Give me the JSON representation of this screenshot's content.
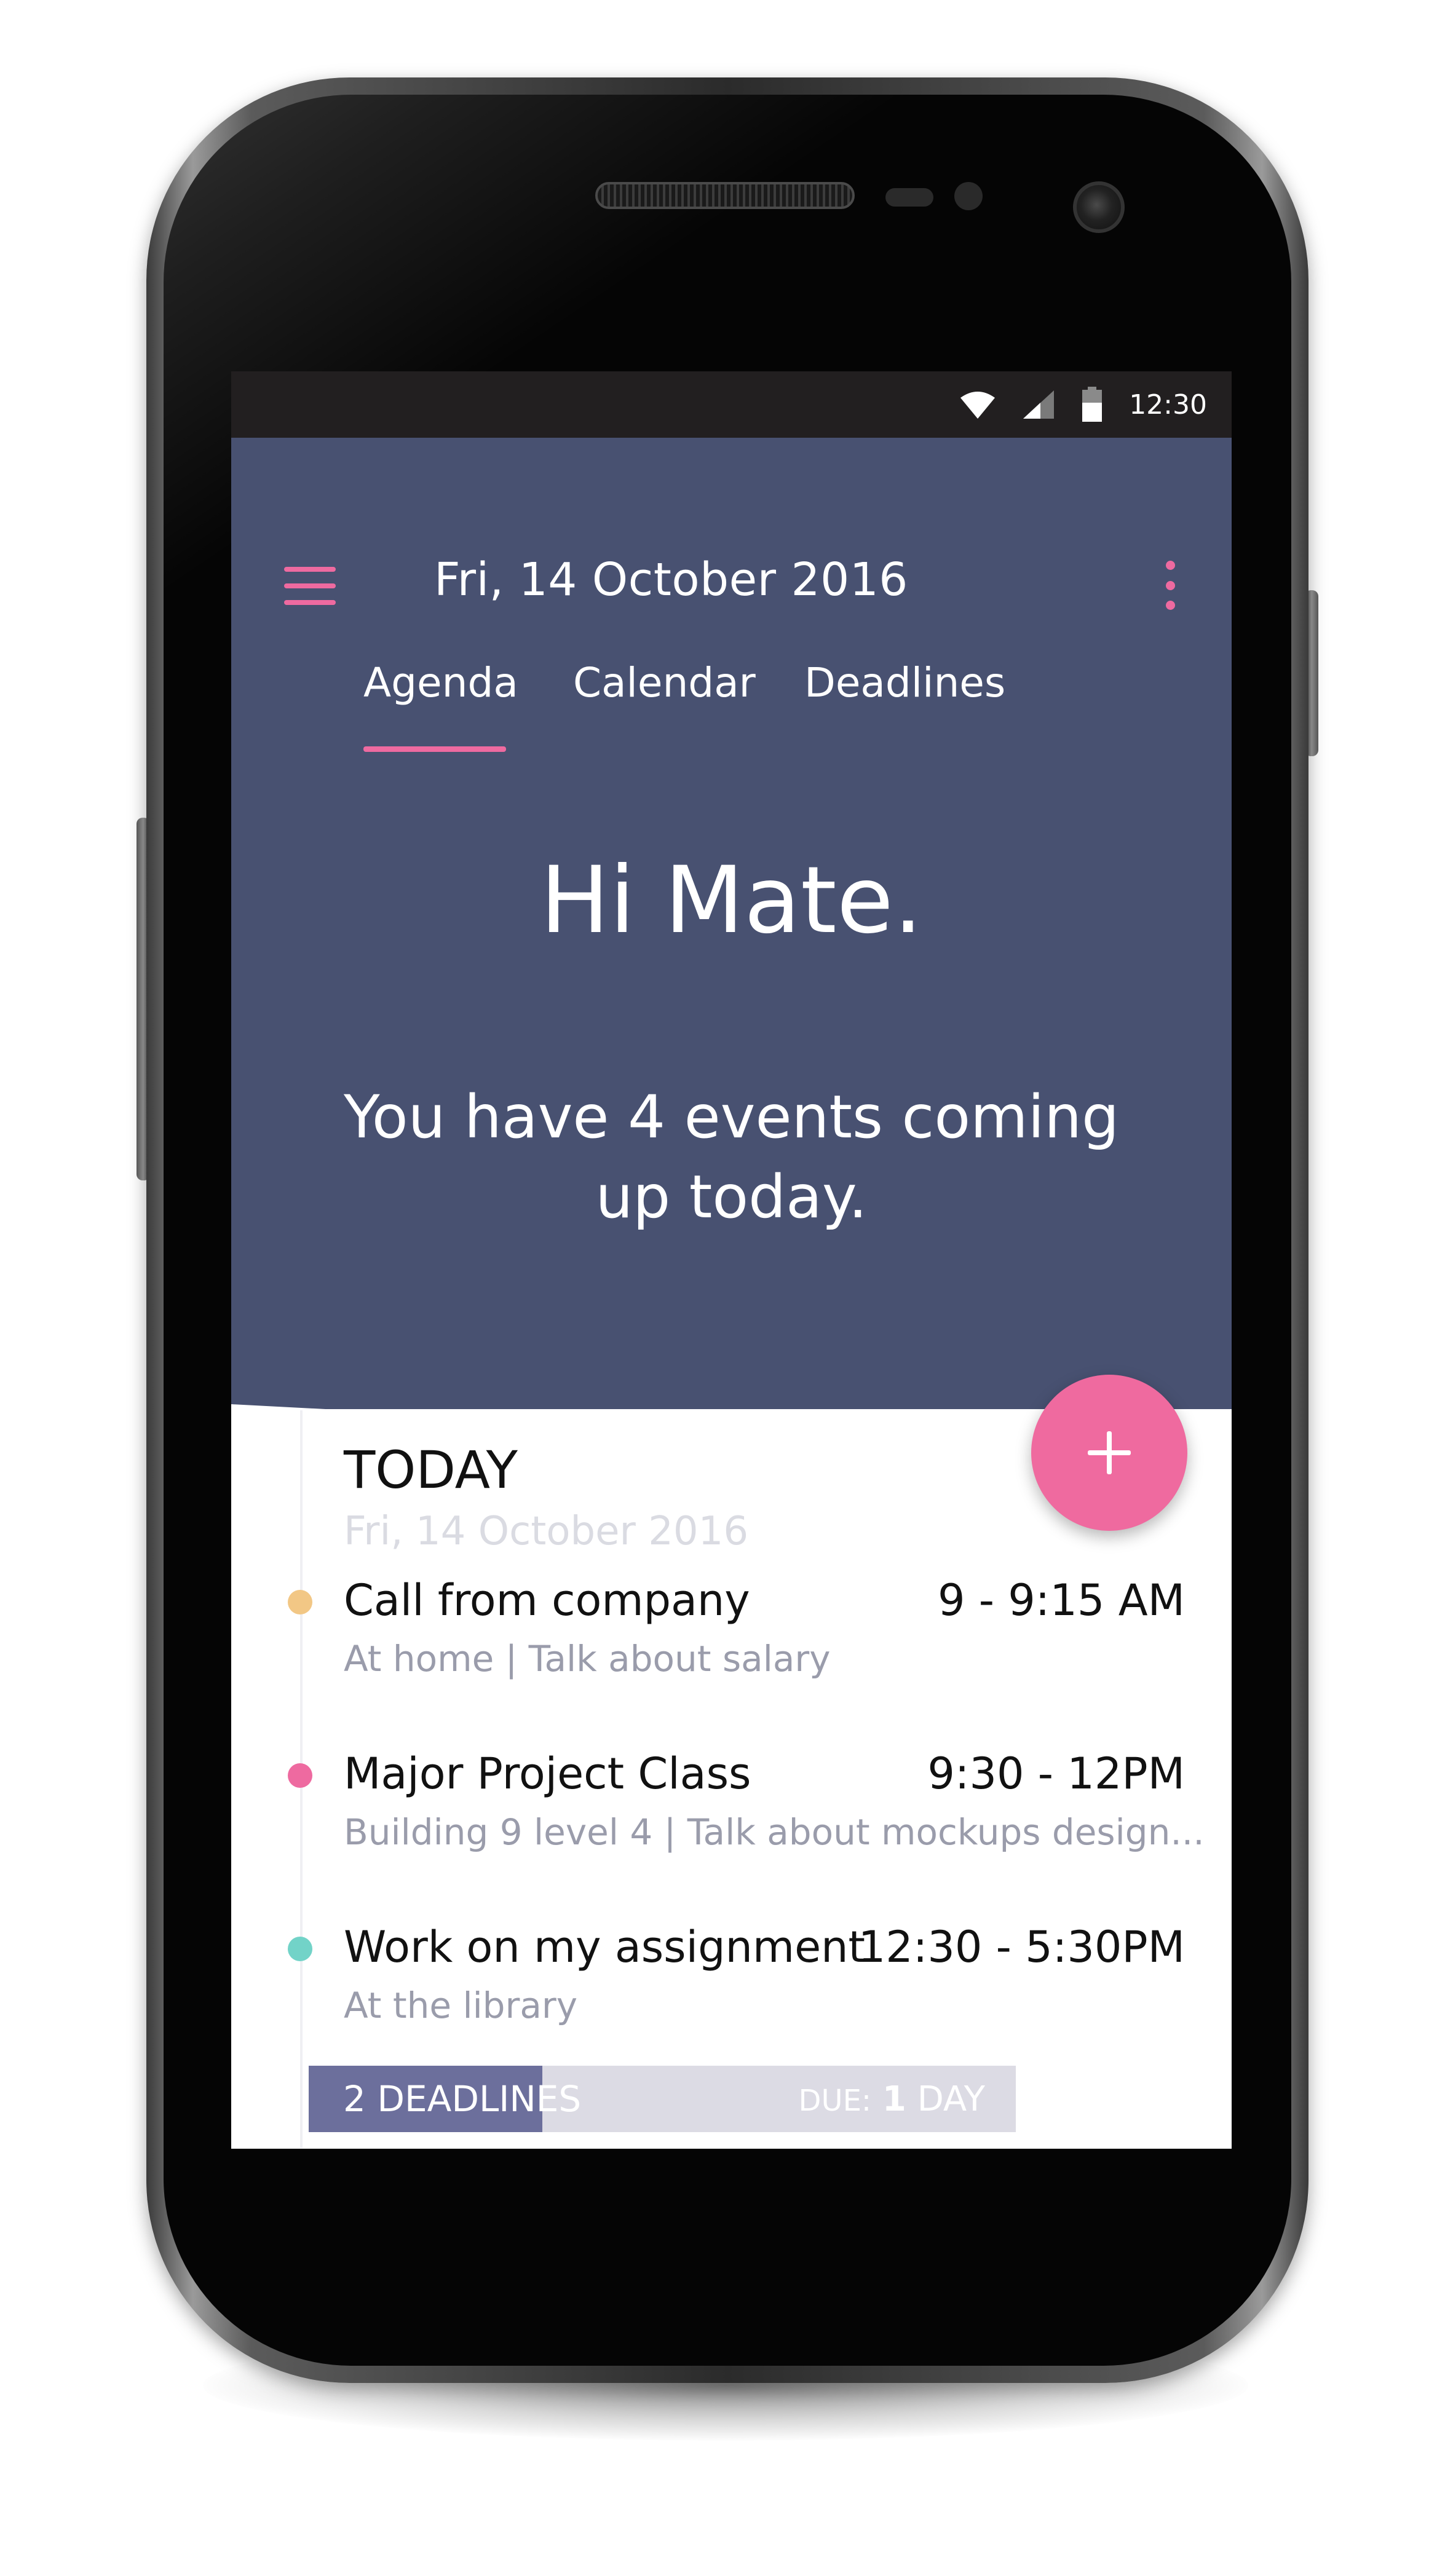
{
  "status_bar": {
    "time": "12:30"
  },
  "header": {
    "date_title": "Fri, 14 October 2016",
    "tabs": [
      {
        "label": "Agenda",
        "active": true
      },
      {
        "label": "Calendar",
        "active": false
      },
      {
        "label": "Deadlines",
        "active": false
      }
    ],
    "greeting": "Hi Mate.",
    "summary": "You have 4 events coming up today."
  },
  "agenda": {
    "section_title": "TODAY",
    "section_date": "Fri, 14 October 2016",
    "events": [
      {
        "title": "Call from company",
        "time": "9 - 9:15 AM",
        "subtitle": "At home | Talk about salary",
        "dot_color": "#f2c785"
      },
      {
        "title": "Major Project Class",
        "time": "9:30 - 12PM",
        "subtitle": "Building 9 level 4 | Talk about mockups design...",
        "dot_color": "#ee6aa0"
      },
      {
        "title": "Work on my assignment",
        "time": "12:30 - 5:30PM",
        "subtitle": "At the library",
        "dot_color": "#72d3c8"
      }
    ]
  },
  "deadlines": {
    "label": "2 DEADLINES",
    "due_prefix": "DUE:",
    "due_number": "1",
    "due_unit": "DAY",
    "progress": 0.33
  },
  "colors": {
    "header_bg": "#485171",
    "accent_pink": "#ee6aa0",
    "status_bar_bg": "#221f20",
    "deadline_fill": "#6c6f9c",
    "deadline_track": "#dcdbe4"
  },
  "icons": {
    "menu": "hamburger-menu-icon",
    "more": "more-vertical-icon",
    "wifi": "wifi-icon",
    "signal": "cell-signal-icon",
    "battery": "battery-icon",
    "fab": "plus-icon"
  }
}
